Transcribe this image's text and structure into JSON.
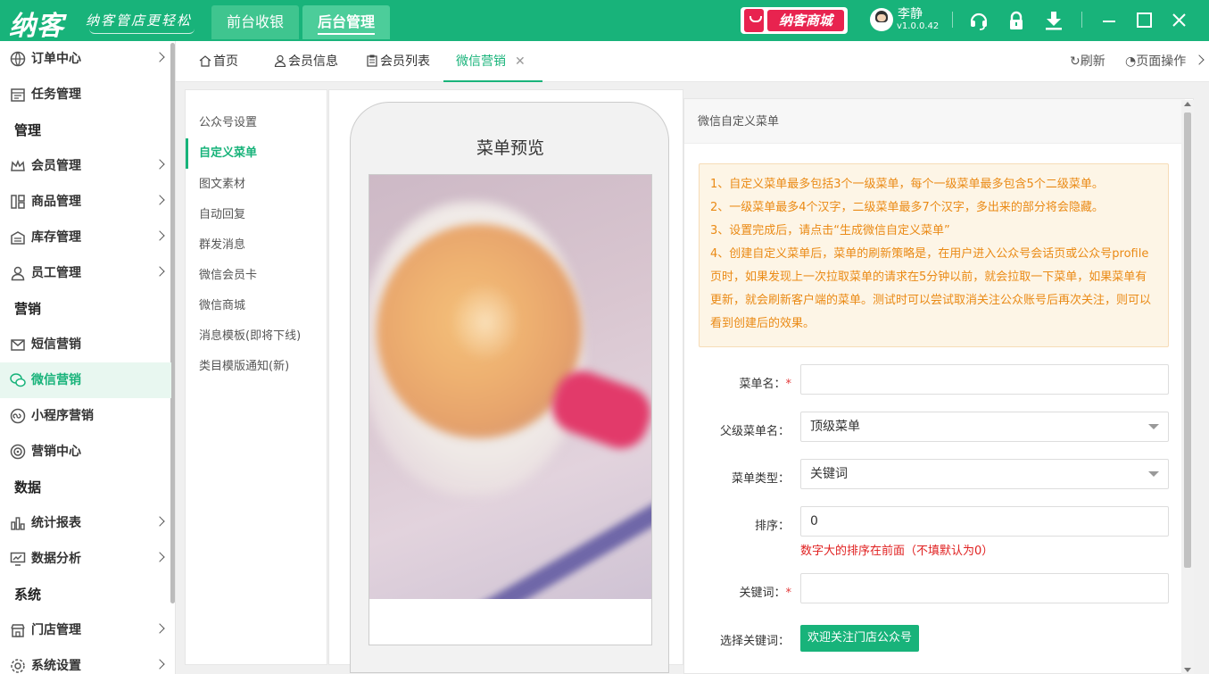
{
  "app": {
    "logo": "纳客",
    "slogan": "纳客管店更轻松",
    "accent_color": "#18b37a"
  },
  "top_tabs": [
    {
      "label": "前台收银",
      "active": false
    },
    {
      "label": "后台管理",
      "active": true
    }
  ],
  "mall": {
    "label": "纳客商城",
    "color": "#e8234f"
  },
  "user": {
    "name": "李静",
    "version": "v1.0.0.42"
  },
  "top_icons": [
    "headset-icon",
    "lock-icon",
    "download-icon",
    "minimize-icon",
    "maximize-icon",
    "close-icon"
  ],
  "sidebar": {
    "items": [
      {
        "label": "订单中心",
        "icon": "globe-icon",
        "arrow": true
      },
      {
        "label": "任务管理",
        "icon": "calendar-icon",
        "arrow": false
      },
      {
        "section": "管理"
      },
      {
        "label": "会员管理",
        "icon": "crown-icon",
        "arrow": true
      },
      {
        "label": "商品管理",
        "icon": "grid-icon",
        "arrow": true
      },
      {
        "label": "库存管理",
        "icon": "warehouse-icon",
        "arrow": true
      },
      {
        "label": "员工管理",
        "icon": "person-icon",
        "arrow": true
      },
      {
        "section": "营销"
      },
      {
        "label": "短信营销",
        "icon": "mail-icon",
        "arrow": false
      },
      {
        "label": "微信营销",
        "icon": "wechat-icon",
        "arrow": false,
        "active": true
      },
      {
        "label": "小程序营销",
        "icon": "miniprogram-icon",
        "arrow": false
      },
      {
        "label": "营销中心",
        "icon": "target-icon",
        "arrow": false
      },
      {
        "section": "数据"
      },
      {
        "label": "统计报表",
        "icon": "bar-chart-icon",
        "arrow": true
      },
      {
        "label": "数据分析",
        "icon": "monitor-chart-icon",
        "arrow": true
      },
      {
        "section": "系统"
      },
      {
        "label": "门店管理",
        "icon": "store-icon",
        "arrow": true
      },
      {
        "label": "系统设置",
        "icon": "gear-icon",
        "arrow": true
      }
    ]
  },
  "tabs": {
    "items": [
      {
        "label": "首页",
        "icon": "home-icon"
      },
      {
        "label": "会员信息",
        "icon": "person-outline-icon"
      },
      {
        "label": "会员列表",
        "icon": "clipboard-icon"
      },
      {
        "label": "微信营销",
        "active": true,
        "closable": true
      }
    ],
    "refresh": "刷新",
    "page_ops": "页面操作"
  },
  "submenu": {
    "items": [
      {
        "label": "公众号设置"
      },
      {
        "label": "自定义菜单",
        "active": true
      },
      {
        "label": "图文素材"
      },
      {
        "label": "自动回复"
      },
      {
        "label": "群发消息"
      },
      {
        "label": "微信会员卡"
      },
      {
        "label": "微信商城"
      },
      {
        "label": "消息模板(即将下线)"
      },
      {
        "label": "类目模版通知(新)"
      }
    ]
  },
  "preview": {
    "title": "菜单预览"
  },
  "form": {
    "header": "微信自定义菜单",
    "notice": [
      "1、自定义菜单最多包括3个一级菜单，每个一级菜单最多包含5个二级菜单。",
      "2、一级菜单最多4个汉字，二级菜单最多7个汉字，多出来的部分将会隐藏。",
      "3、设置完成后，请点击“生成微信自定义菜单”",
      "4、创建自定义菜单后，菜单的刷新策略是，在用户进入公众号会话页或公众号profile页时，如果发现上一次拉取菜单的请求在5分钟以前，就会拉取一下菜单，如果菜单有更新，就会刷新客户端的菜单。测试时可以尝试取消关注公众账号后再次关注，则可以看到创建后的效果。"
    ],
    "menu_name": {
      "label": "菜单名：",
      "value": ""
    },
    "parent_menu": {
      "label": "父级菜单名：",
      "value": "顶级菜单"
    },
    "menu_type": {
      "label": "菜单类型：",
      "value": "关键词"
    },
    "sort": {
      "label": "排序：",
      "value": "0",
      "hint": "数字大的排序在前面（不填默认为0）"
    },
    "keyword": {
      "label": "关键词：",
      "value": ""
    },
    "choose_keyword": {
      "label": "选择关键词：",
      "button": "欢迎关注门店公众号"
    }
  }
}
